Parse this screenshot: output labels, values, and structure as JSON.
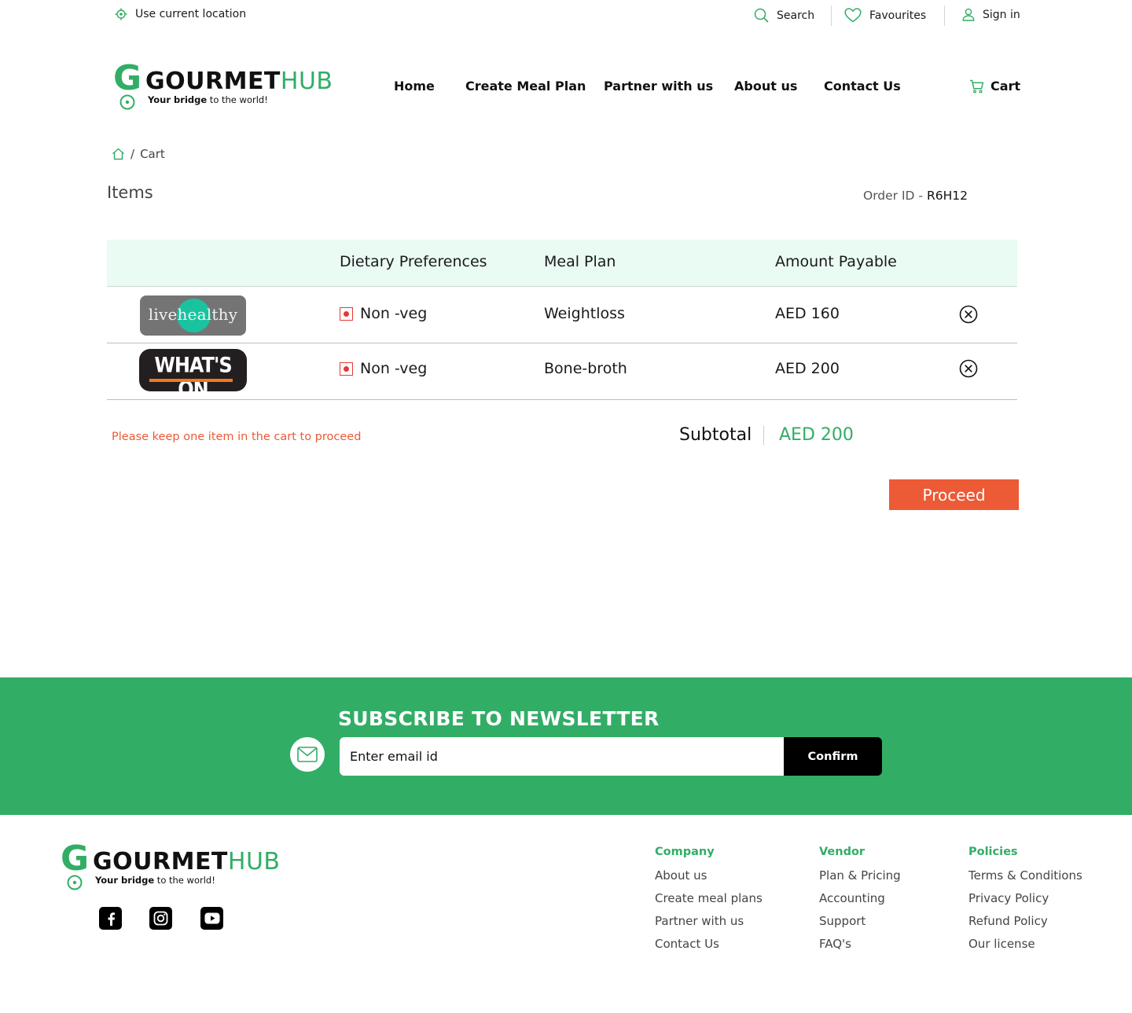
{
  "topbar": {
    "location": "Use current location",
    "search": "Search",
    "favourites": "Favourites",
    "sign_in": "Sign in"
  },
  "logo": {
    "letter": "G",
    "brand_bold": "GOURMET",
    "brand_light": "HUB",
    "tagline_bold": "Your bridge",
    "tagline_rest": " to the world!"
  },
  "nav": {
    "home": "Home",
    "create_meal_plan": "Create Meal Plan",
    "partner": "Partner with us",
    "about": "About us",
    "contact": "Contact Us",
    "cart": "Cart"
  },
  "breadcrumb": {
    "separator": "/",
    "current": "Cart"
  },
  "cart": {
    "heading": "Items",
    "order_id_label": "Order ID -",
    "order_id": "R6H12",
    "columns": {
      "dietary": "Dietary Preferences",
      "meal_plan": "Meal Plan",
      "amount": "Amount Payable"
    },
    "rows": [
      {
        "brand_pre": "live",
        "brand_mid": "heal",
        "brand_post": "thy",
        "dietary": "Non -veg",
        "meal_plan": "Weightloss",
        "amount": "AED 160"
      },
      {
        "brand": "WHAT'S ON",
        "dietary": "Non -veg",
        "meal_plan": "Bone-broth",
        "amount": "AED 200"
      }
    ],
    "warning": "Please keep one item in the cart to proceed",
    "subtotal_label": "Subtotal",
    "subtotal_value": "AED 200",
    "proceed": "Proceed"
  },
  "newsletter": {
    "title": "SUBSCRIBE TO NEWSLETTER",
    "placeholder": "Enter email id",
    "confirm": "Confirm"
  },
  "footer": {
    "company": {
      "heading": "Company",
      "links": [
        "About us",
        "Create meal plans",
        "Partner with us",
        "Contact Us"
      ]
    },
    "vendor": {
      "heading": "Vendor",
      "links": [
        "Plan & Pricing",
        "Accounting",
        "Support",
        "FAQ's"
      ]
    },
    "policies": {
      "heading": "Policies",
      "links": [
        "Terms & Conditions",
        "Privacy Policy",
        "Refund Policy",
        "Our license"
      ]
    }
  },
  "colors": {
    "brand_green": "#32ad66",
    "accent_orange": "#ec5a36",
    "table_header_bg": "#e9fbf3",
    "nonveg_red": "#e53935"
  },
  "icons": [
    "location-icon",
    "search-icon",
    "heart-icon",
    "user-icon",
    "cart-icon",
    "home-icon",
    "close-circle-icon",
    "mail-icon",
    "facebook-icon",
    "instagram-icon",
    "youtube-icon"
  ]
}
